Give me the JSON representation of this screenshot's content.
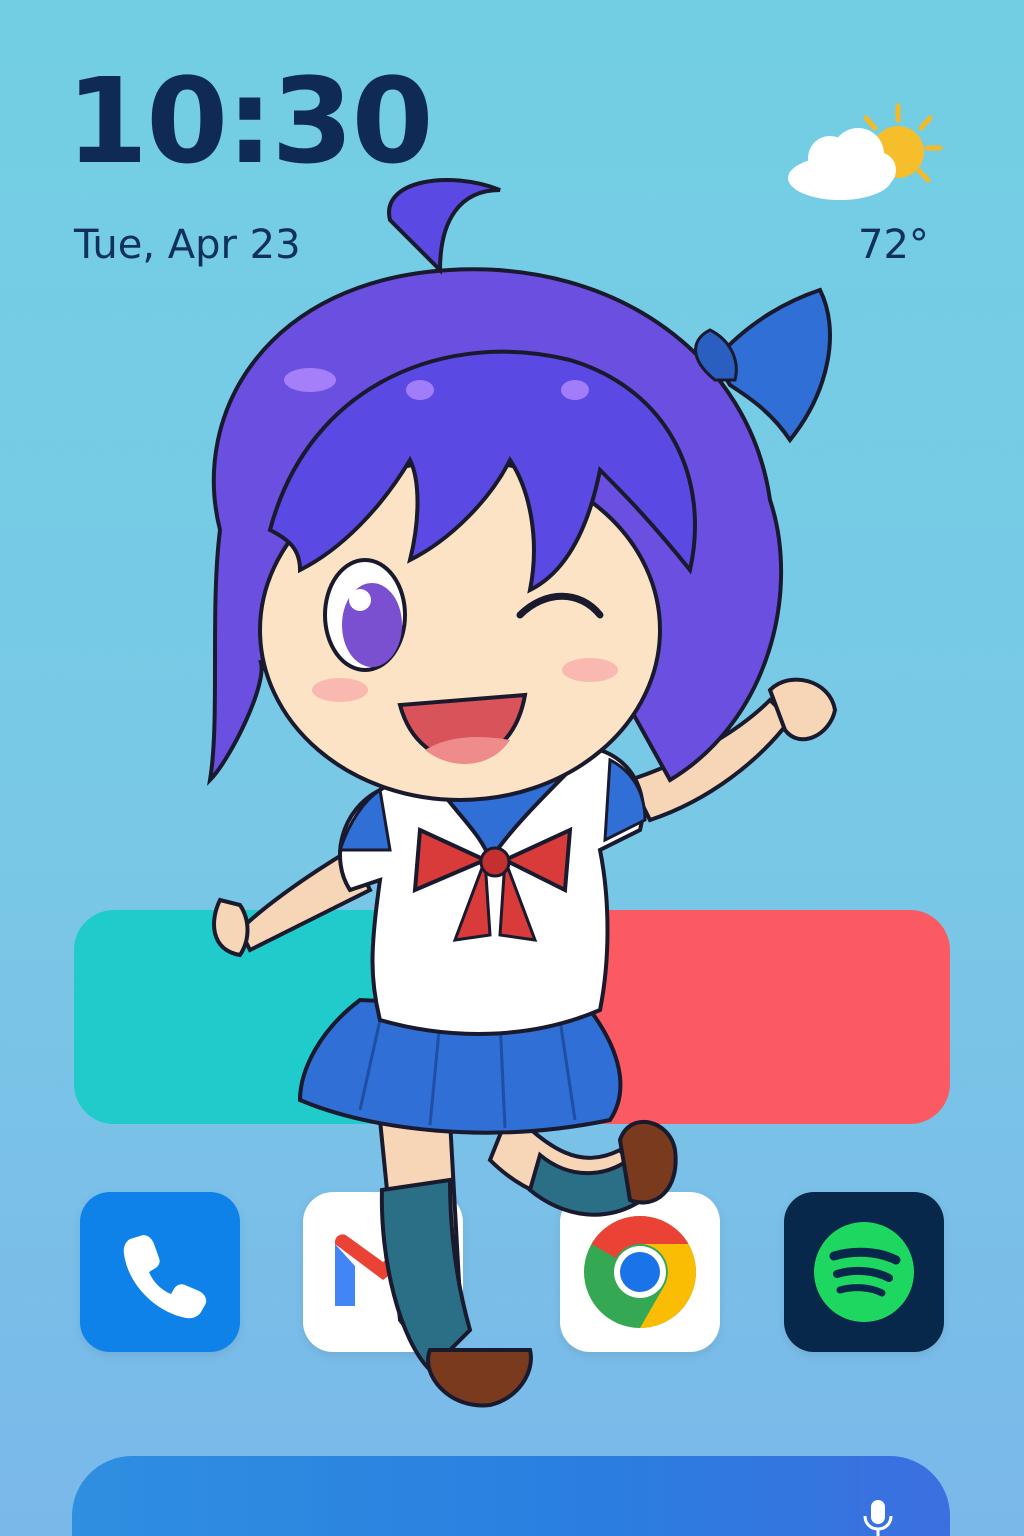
{
  "status": {
    "time": "10:30",
    "date": "Tue, Apr 23",
    "weather": {
      "icon": "partly-cloudy-icon",
      "temperature": "72°"
    }
  },
  "widgets": {
    "left_color": "#1fcbcb",
    "right_color": "#fc5a63"
  },
  "dock": {
    "apps": [
      {
        "name": "Phone",
        "icon": "phone-icon",
        "color": "#0f82ea"
      },
      {
        "name": "Gmail",
        "icon": "gmail-icon",
        "color": "#ffffff"
      },
      {
        "name": "Chrome",
        "icon": "chrome-icon",
        "color": "#ffffff"
      },
      {
        "name": "Spotify",
        "icon": "spotify-icon",
        "color": "#07284a"
      }
    ]
  },
  "search": {
    "icon": "mic-icon"
  },
  "wallpaper": {
    "subject": "anime-character-illustration"
  }
}
